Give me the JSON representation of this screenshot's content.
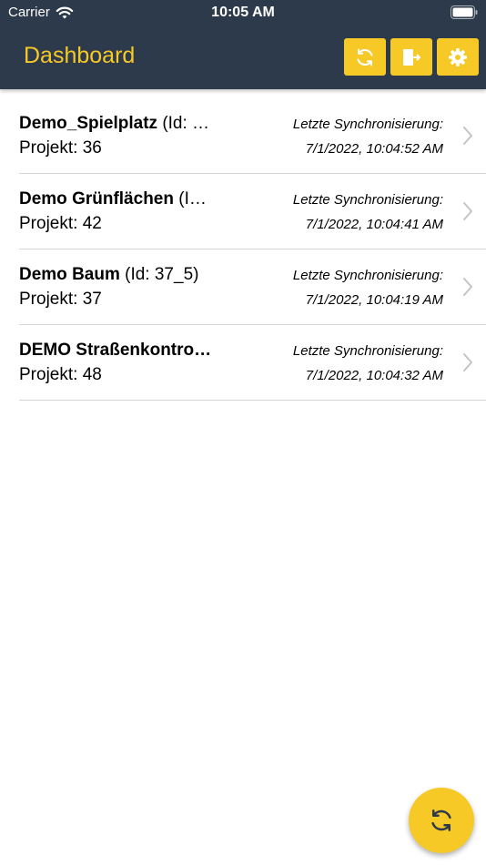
{
  "status_bar": {
    "carrier": "Carrier",
    "time": "10:05 AM"
  },
  "nav": {
    "title": "Dashboard",
    "buttons": [
      {
        "icon": "sync-icon"
      },
      {
        "icon": "logout-icon"
      },
      {
        "icon": "gear-icon"
      }
    ]
  },
  "colors": {
    "header_bg": "#2c3a4b",
    "accent": "#f7c927"
  },
  "projects": [
    {
      "name": "Demo_Spielplatz",
      "id_suffix": " (Id: …",
      "project": "Projekt: 36",
      "sync_label": "Letzte Synchronisierung:",
      "sync_time": "7/1/2022, 10:04:52 AM"
    },
    {
      "name": "Demo Grünflächen",
      "id_suffix": " (I…",
      "project": "Projekt: 42",
      "sync_label": "Letzte Synchronisierung:",
      "sync_time": "7/1/2022, 10:04:41 AM"
    },
    {
      "name": "Demo Baum",
      "id_suffix": " (Id: 37_5)",
      "project": "Projekt: 37",
      "sync_label": "Letzte Synchronisierung:",
      "sync_time": "7/1/2022, 10:04:19 AM"
    },
    {
      "name": "DEMO Straßenkontro…",
      "id_suffix": "",
      "project": "Projekt: 48",
      "sync_label": "Letzte Synchronisierung:",
      "sync_time": "7/1/2022, 10:04:32 AM"
    }
  ],
  "fab": {
    "icon": "sync-icon"
  }
}
